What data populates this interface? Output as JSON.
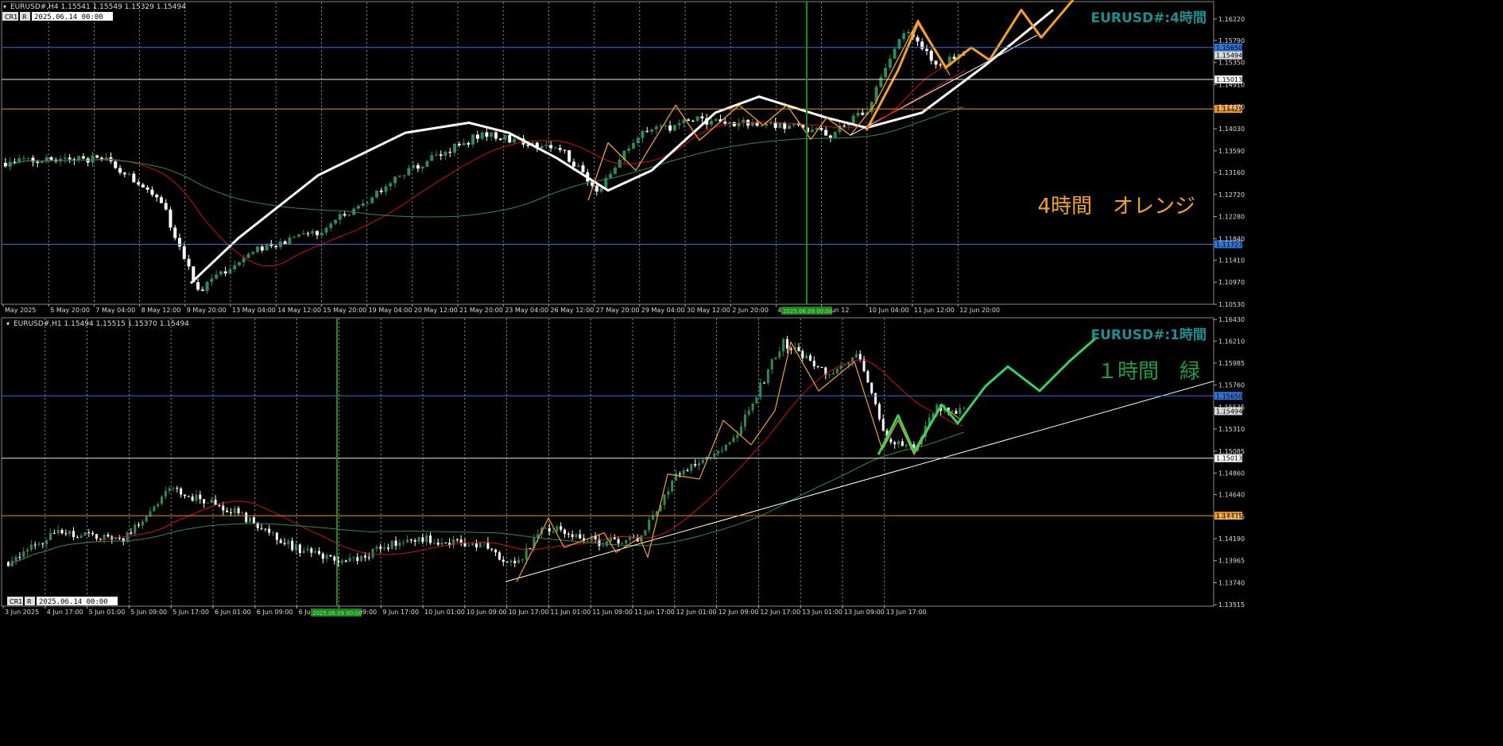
{
  "colors": {
    "background": "#000000",
    "grid": "#c8c8c8",
    "axis_text": "#dcdcdc",
    "bull": "#2e8b57",
    "bear": "#ffffff",
    "ma_red": "#d01010",
    "ma_green": "#2e8b57",
    "orange": "#f4a12c",
    "white_line": "#ffffff",
    "green_proj": "#3cd05a",
    "blue_line": "#2f73d8",
    "orange_line": "#e6961e",
    "white_hline": "#e8e8e8",
    "vline_green": "#1a8a1a",
    "title_teal": "#1f8f8f",
    "label_orange": "#f4a12c",
    "label_green": "#1e9e3e"
  },
  "top": {
    "header": "EURUSD#,H4  1.15541 1.15549 1.15329 1.15494",
    "cr_button": "CR1",
    "r_button": "R",
    "date_box": "2025.06.14 00:00",
    "title": "EURUSD#:4時間",
    "annotation": "4時間　オレンジ",
    "y_ticks": [
      "1.16220",
      "1.15790",
      "1.15350",
      "1.14910",
      "1.14470",
      "1.14030",
      "1.13590",
      "1.13160",
      "1.12720",
      "1.12280",
      "1.11840",
      "1.11410",
      "1.10970",
      "1.10530"
    ],
    "x_ticks": [
      "May 2025",
      "5 May 20:00",
      "7 May 04:00",
      "8 May 12:00",
      "9 May 20:00",
      "13 May 04:00",
      "14 May 12:00",
      "15 May 20:00",
      "19 May 04:00",
      "20 May 12:00",
      "21 May 20:00",
      "23 May 04:00",
      "26 May 12:00",
      "27 May 20:00",
      "29 May 04:00",
      "30 May 12:00",
      "2 Jun 20:00",
      "4 Jun 04:00",
      "5 Jun 12",
      "10 Jun 04:00",
      "11 Jun 12:00",
      "12 Jun 20:00"
    ],
    "cursor_date_label": "2025.06.09 00:00",
    "hlines": [
      {
        "name": "blue-upper",
        "price": "1.15650",
        "color": "#2f73d8",
        "label_bg": "#2f73d8"
      },
      {
        "name": "current",
        "price": "1.15494",
        "color": "none",
        "label_bg": "#d8d8d8"
      },
      {
        "name": "white",
        "price": "1.15013",
        "color": "#e8e8e8",
        "label_bg": "#ffffff"
      },
      {
        "name": "orange",
        "price": "1.14425",
        "color": "#e6961e",
        "label_bg": "#e6961e"
      },
      {
        "name": "blue-lower",
        "price": "1.11727",
        "color": "#2f73d8",
        "label_bg": "#2f73d8"
      }
    ]
  },
  "bottom": {
    "header": "EURUSD#,H1  1.15494 1.15515 1.15370 1.15494",
    "cr_button": "CR1",
    "r_button": "R",
    "date_box": "2025.06.14 00:00",
    "title": "EURUSD#:1時間",
    "annotation": "１時間　緑",
    "y_ticks": [
      "1.16430",
      "1.16210",
      "1.15985",
      "1.15760",
      "1.15535",
      "1.15310",
      "1.15085",
      "1.14860",
      "1.14640",
      "1.14415",
      "1.14190",
      "1.13965",
      "1.13740",
      "1.13515"
    ],
    "x_ticks": [
      "3 Jun 2025",
      "4 Jun 17:00",
      "5 Jun 01:00",
      "5 Jun 09:00",
      "5 Jun 17:00",
      "6 Jun 01:00",
      "6 Jun 09:00",
      "6 Jun",
      "9 Jun 09:00",
      "9 Jun 17:00",
      "10 Jun 01:00",
      "10 Jun 09:00",
      "10 Jun 17:00",
      "11 Jun 01:00",
      "11 Jun 09:00",
      "11 Jun 17:00",
      "12 Jun 01:00",
      "12 Jun 09:00",
      "12 Jun 17:00",
      "13 Jun 01:00",
      "13 Jun 09:00",
      "13 Jun 17:00"
    ],
    "cursor_date_label": "2025.06.09 00:00",
    "hlines": [
      {
        "name": "blue-upper",
        "price": "1.15650",
        "color": "#2f73d8",
        "label_bg": "#2f73d8"
      },
      {
        "name": "current",
        "price": "1.15494",
        "color": "none",
        "label_bg": "#d8d8d8"
      },
      {
        "name": "white",
        "price": "1.15013",
        "color": "#e8e8e8",
        "label_bg": "#ffffff"
      },
      {
        "name": "orange",
        "price": "1.14425",
        "color": "#e6961e",
        "label_bg": "#e6961e"
      }
    ]
  },
  "chart_data": [
    {
      "type": "candlestick",
      "title": "EURUSD#:4時間",
      "timeframe": "H4",
      "ylim": [
        1.1053,
        1.1655
      ],
      "y_ticks": [
        1.1622,
        1.1579,
        1.1535,
        1.1491,
        1.1447,
        1.1403,
        1.1359,
        1.1316,
        1.1272,
        1.1228,
        1.1184,
        1.1141,
        1.1097,
        1.1053
      ],
      "price_levels": [
        1.1565,
        1.15494,
        1.15013,
        1.14425,
        1.11727
      ],
      "last_ohlc": {
        "open": 1.15541,
        "high": 1.15549,
        "low": 1.15329,
        "close": 1.15494
      },
      "annotations": [
        "4時間　オレンジ"
      ]
    },
    {
      "type": "candlestick",
      "title": "EURUSD#:1時間",
      "timeframe": "H1",
      "ylim": [
        1.135,
        1.1644
      ],
      "y_ticks": [
        1.1643,
        1.1621,
        1.15985,
        1.1576,
        1.15535,
        1.1531,
        1.15085,
        1.1486,
        1.1464,
        1.14415,
        1.1419,
        1.13965,
        1.1374,
        1.13515
      ],
      "price_levels": [
        1.1565,
        1.15494,
        1.15013,
        1.14425
      ],
      "last_ohlc": {
        "open": 1.15494,
        "high": 1.15515,
        "low": 1.1537,
        "close": 1.15494
      },
      "annotations": [
        "１時間　緑"
      ]
    }
  ]
}
